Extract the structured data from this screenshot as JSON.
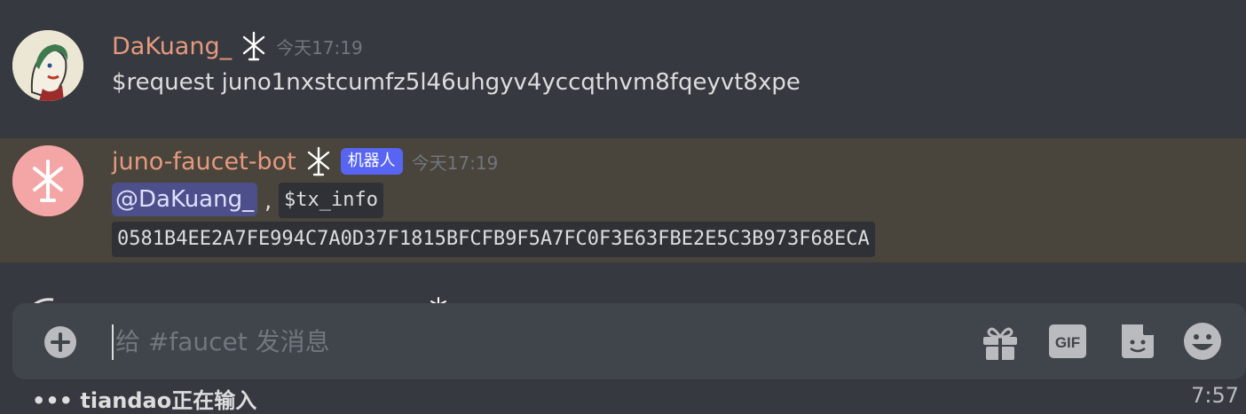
{
  "messages": [
    {
      "username": "DaKuang_",
      "timestamp": "今天17:19",
      "content": "$request juno1nxstcumfz5l46uhgyv4yccqthvm8fqeyvt8xpe"
    },
    {
      "username": "juno-faucet-bot",
      "bot_tag": "机器人",
      "timestamp": "今天17:19",
      "mention": "@DaKuang_",
      "separator": ",",
      "code1": "$tx_info",
      "code2": "0581B4EE2A7FE994C7A0D37F1815BFCFB9F5A7FC0F3E63FBE2E5C3B973F68ECA"
    }
  ],
  "composer": {
    "placeholder": "给 #faucet 发消息"
  },
  "typing": "••• tiandao正在输入",
  "clock": "7:57",
  "colors": {
    "background": "#36393f",
    "highlight_row": "#49443c",
    "username": "#e59a7d",
    "bot_tag": "#5865f2",
    "mention_bg": "#4d4f8a"
  }
}
